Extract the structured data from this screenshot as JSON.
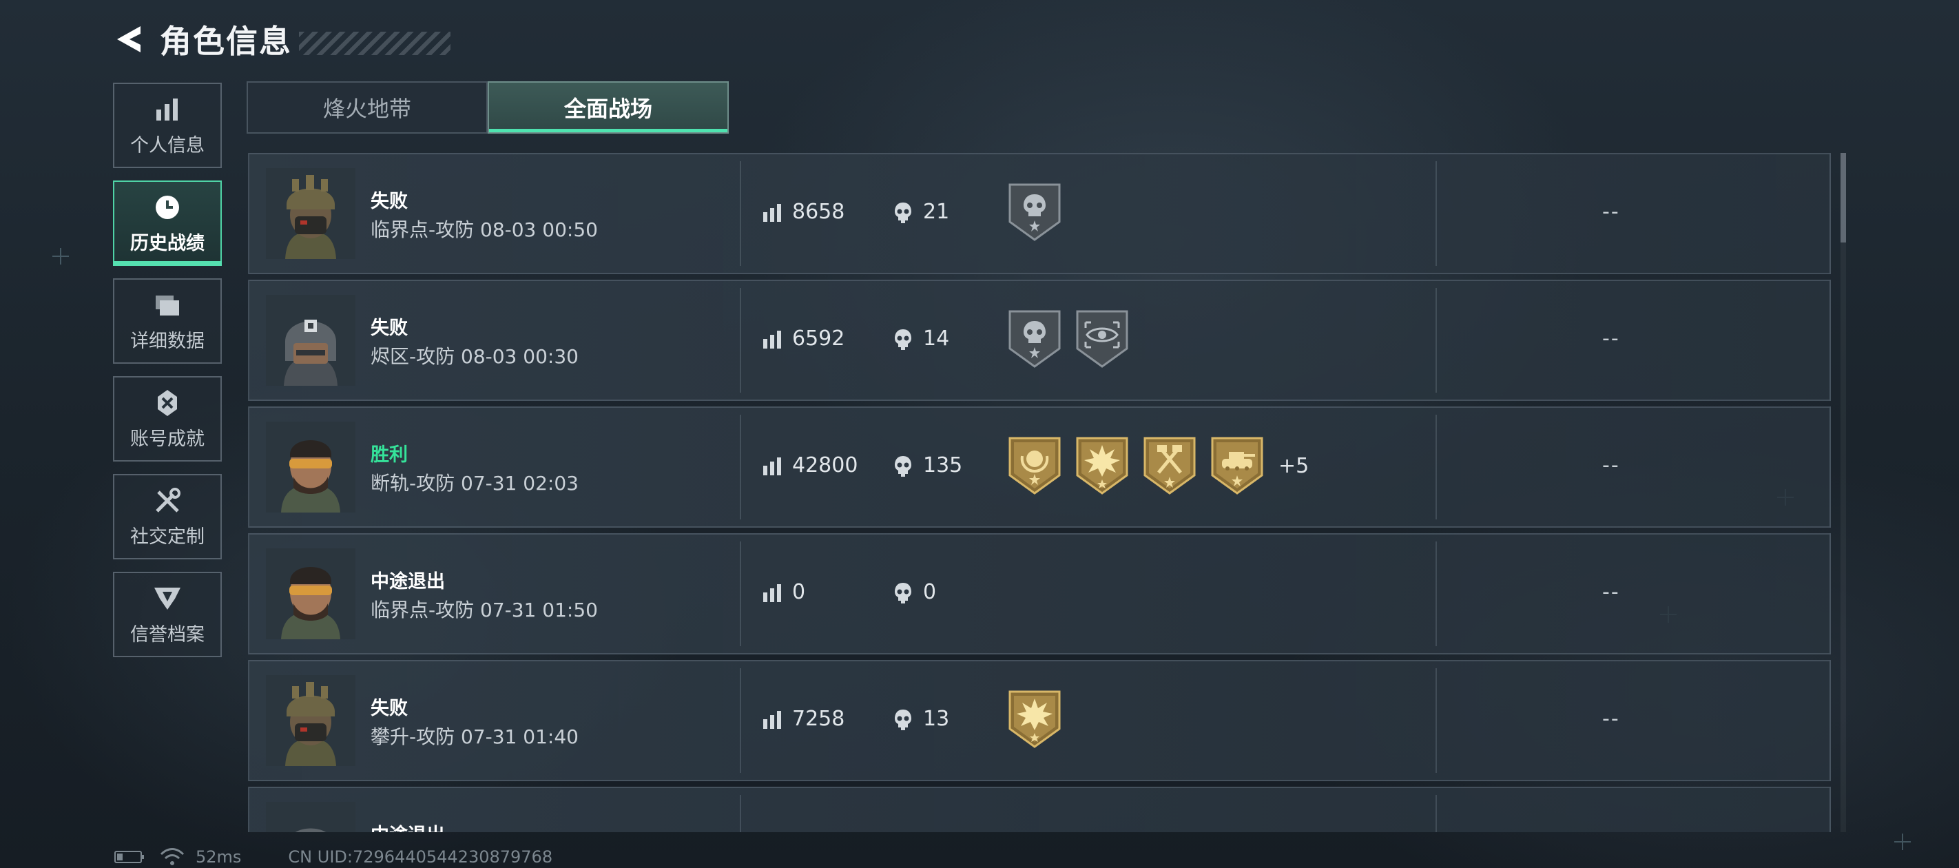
{
  "header": {
    "title": "角色信息",
    "back_icon": "back-arrow-icon"
  },
  "sidebar": {
    "items": [
      {
        "label": "个人信息",
        "icon": "bar-chart-icon",
        "active": false
      },
      {
        "label": "历史战绩",
        "icon": "clock-history-icon",
        "active": true
      },
      {
        "label": "详细数据",
        "icon": "folder-icon",
        "active": false
      },
      {
        "label": "账号成就",
        "icon": "achievement-badge-icon",
        "active": false
      },
      {
        "label": "社交定制",
        "icon": "tools-icon",
        "active": false
      },
      {
        "label": "信誉档案",
        "icon": "emblem-icon",
        "active": false
      }
    ]
  },
  "tabs": [
    {
      "label": "烽火地带",
      "active": false
    },
    {
      "label": "全面战场",
      "active": true
    }
  ],
  "matches": [
    {
      "result": "失败",
      "map": "临界点-攻防 08-03 00:50",
      "score": "8658",
      "kills": "21",
      "medals": [
        "skull-medal-icon"
      ],
      "extra": "",
      "value": "--"
    },
    {
      "result": "失败",
      "map": "烬区-攻防 08-03 00:30",
      "score": "6592",
      "kills": "14",
      "medals": [
        "skull-medal-icon",
        "eye-target-medal-icon"
      ],
      "extra": "",
      "value": "--"
    },
    {
      "result": "胜利",
      "map": "断轨-攻防 07-31 02:03",
      "score": "42800",
      "kills": "135",
      "medals": [
        "wreath-medal-icon",
        "explosion-medal-icon",
        "crossed-tools-medal-icon",
        "tank-medal-icon"
      ],
      "extra": "+5",
      "value": "--"
    },
    {
      "result": "中途退出",
      "map": "临界点-攻防 07-31 01:50",
      "score": "0",
      "kills": "0",
      "medals": [],
      "extra": "",
      "value": "--"
    },
    {
      "result": "失败",
      "map": "攀升-攻防 07-31 01:40",
      "score": "7258",
      "kills": "13",
      "medals": [
        "explosion-medal-icon"
      ],
      "extra": "",
      "value": "--"
    },
    {
      "result": "中途退出",
      "map": "",
      "score": "",
      "kills": "",
      "medals": [],
      "extra": "",
      "value": ""
    }
  ],
  "status_bar": {
    "ping": "52ms",
    "uid": "CN UID:7296440544230879768"
  },
  "colors": {
    "accent": "#4ee3b0",
    "win": "#35e39a",
    "gold_medal": "#c9a75a",
    "grey_medal": "#5a6167"
  }
}
